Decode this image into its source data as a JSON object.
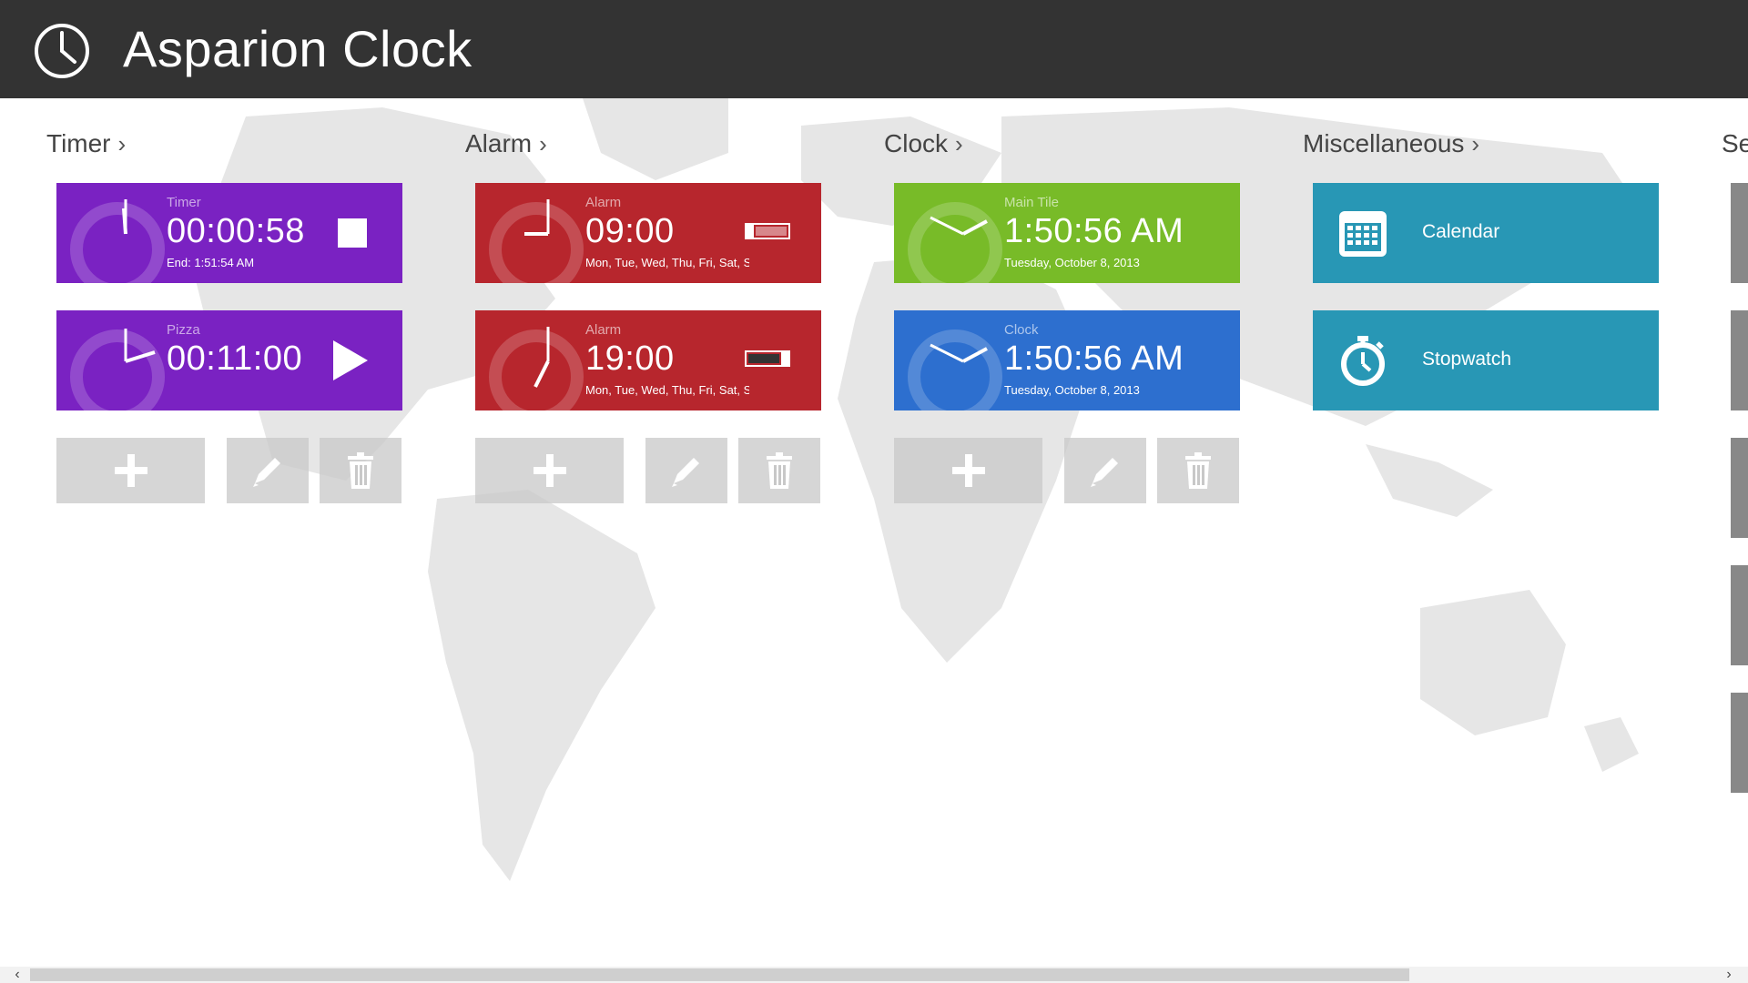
{
  "app": {
    "title": "Asparion Clock",
    "icon": "clock-icon"
  },
  "sections": {
    "timer": {
      "title": "Timer",
      "chevron": "›"
    },
    "alarm": {
      "title": "Alarm",
      "chevron": "›"
    },
    "clock": {
      "title": "Clock",
      "chevron": "›"
    },
    "misc": {
      "title": "Miscellaneous",
      "chevron": "›"
    },
    "settings": {
      "title": "Se"
    }
  },
  "timers": [
    {
      "label": "Timer",
      "value": "00:00:58",
      "sub": "End: 1:51:54 AM",
      "action": "stop-icon"
    },
    {
      "label": "Pizza",
      "value": "00:11:00",
      "sub": "",
      "action": "play-icon"
    }
  ],
  "alarms": [
    {
      "label": "Alarm",
      "value": "09:00",
      "sub": "Mon, Tue, Wed, Thu, Fri, Sat, Su",
      "enabled": false
    },
    {
      "label": "Alarm",
      "value": "19:00",
      "sub": "Mon, Tue, Wed, Thu, Fri, Sat, Su",
      "enabled": true
    }
  ],
  "clocks": [
    {
      "label": "Main Tile",
      "value": "1:50:56 AM",
      "sub": "Tuesday, October 8, 2013"
    },
    {
      "label": "Clock",
      "value": "1:50:56 AM",
      "sub": "Tuesday, October 8, 2013"
    }
  ],
  "misc": [
    {
      "label": "Calendar",
      "icon": "calendar-icon"
    },
    {
      "label": "Stopwatch",
      "icon": "stopwatch-icon"
    }
  ],
  "colors": {
    "header": "#333333",
    "timer": "#7a22c2",
    "alarm": "#b7262d",
    "main_tile": "#78bb28",
    "clock": "#2d6fcf",
    "misc": "#2897b5"
  }
}
